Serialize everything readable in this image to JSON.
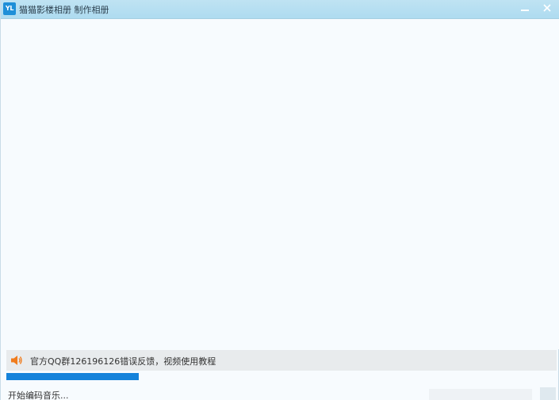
{
  "window": {
    "logo_text": "YL",
    "title": "猫猫影楼相册 制作相册"
  },
  "notice": {
    "icon": "speaker-icon",
    "text": "官方QQ群126196126错误反馈，视频使用教程"
  },
  "progress": {
    "fraction": 0.24,
    "color": "#1583db"
  },
  "status": {
    "text": "开始编码音乐..."
  }
}
